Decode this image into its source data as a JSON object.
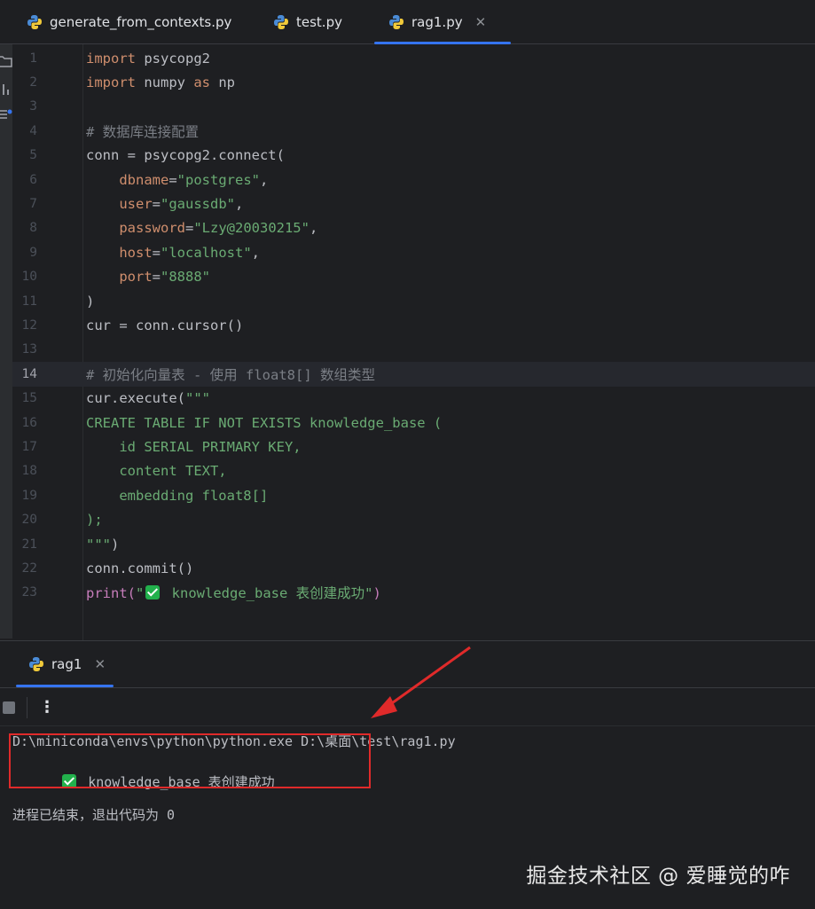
{
  "tabs": [
    {
      "label": "generate_from_contexts.py",
      "active": false
    },
    {
      "label": "test.py",
      "active": false
    },
    {
      "label": "rag1.py",
      "active": true
    }
  ],
  "editor": {
    "current_line": 14,
    "line_numbers": [
      "1",
      "2",
      "3",
      "4",
      "5",
      "6",
      "7",
      "8",
      "9",
      "10",
      "11",
      "12",
      "13",
      "14",
      "15",
      "16",
      "17",
      "18",
      "19",
      "20",
      "21",
      "22",
      "23"
    ],
    "code": {
      "l1_kw": "import",
      "l1_rest": " psycopg2",
      "l2_kw": "import",
      "l2_mid": " numpy ",
      "l2_kw2": "as",
      "l2_rest": " np",
      "l4": "# 数据库连接配置",
      "l5": "conn = psycopg2.connect(",
      "l6_p": "dbname",
      "l6_s": "\"postgres\"",
      "l6_e": ",",
      "l7_p": "user",
      "l7_s": "\"gaussdb\"",
      "l7_e": ",",
      "l8_p": "password",
      "l8_s": "\"Lzy@20030215\"",
      "l8_e": ",",
      "l9_p": "host",
      "l9_s": "\"localhost\"",
      "l9_e": ",",
      "l10_p": "port",
      "l10_s": "\"8888\"",
      "l11": ")",
      "l12": "cur = conn.cursor()",
      "l14": "# 初始化向量表 - 使用 float8[] 数组类型",
      "l15_a": "cur.execute(",
      "l15_s": "\"\"\"",
      "l16": "CREATE TABLE IF NOT EXISTS knowledge_base (",
      "l17": "    id SERIAL PRIMARY KEY,",
      "l18": "    content TEXT,",
      "l19": "    embedding float8[]",
      "l20": ");",
      "l21_s": "\"\"\"",
      "l21_e": ")",
      "l22": "conn.commit()",
      "l23_a": "print(",
      "l23_q": "\"",
      "l23_s": " knowledge_base 表创建成功\"",
      "l23_e": ")"
    }
  },
  "run_panel": {
    "tab_label": "rag1",
    "command": "D:\\miniconda\\envs\\python\\python.exe D:\\桌面\\test\\rag1.py",
    "output_text": " knowledge_base 表创建成功",
    "exit_message": "进程已结束，退出代码为 0"
  },
  "watermark": "掘金技术社区 @ 爱睡觉的咋",
  "colors": {
    "accent": "#3574f0",
    "annotation": "#e02a2a",
    "success": "#22b14c"
  }
}
